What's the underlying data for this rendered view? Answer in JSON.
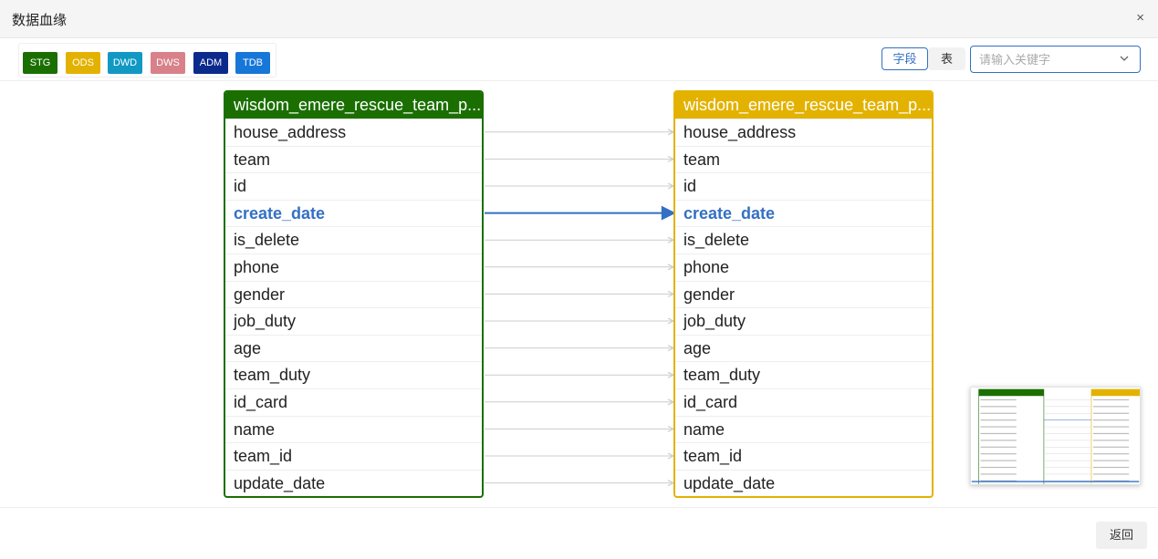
{
  "dialog": {
    "title": "数据血缘",
    "close_label": "×"
  },
  "legend": [
    {
      "label": "STG",
      "color": "#1a6f00"
    },
    {
      "label": "ODS",
      "color": "#e3b200"
    },
    {
      "label": "DWD",
      "color": "#1199c4"
    },
    {
      "label": "DWS",
      "color": "#d98189"
    },
    {
      "label": "ADM",
      "color": "#0b2a8c"
    },
    {
      "label": "TDB",
      "color": "#1677d8"
    }
  ],
  "view_toggle": {
    "field_label": "字段",
    "table_label": "表",
    "active": "字段"
  },
  "search": {
    "value": "",
    "placeholder": "请输入关键字"
  },
  "source_table": {
    "name": "wisdom_emere_rescue_team_p...",
    "color": "#1a6f00",
    "fields": [
      "house_address",
      "team",
      "id",
      "create_date",
      "is_delete",
      "phone",
      "gender",
      "job_duty",
      "age",
      "team_duty",
      "id_card",
      "name",
      "team_id",
      "update_date"
    ]
  },
  "target_table": {
    "name": "wisdom_emere_rescue_team_p...",
    "color": "#e3b200",
    "fields": [
      "house_address",
      "team",
      "id",
      "create_date",
      "is_delete",
      "phone",
      "gender",
      "job_duty",
      "age",
      "team_duty",
      "id_card",
      "name",
      "team_id",
      "update_date"
    ]
  },
  "highlighted_field": "create_date",
  "colors": {
    "accent": "#3370c4",
    "link": "#cccccc"
  },
  "footer": {
    "back_label": "返回"
  }
}
